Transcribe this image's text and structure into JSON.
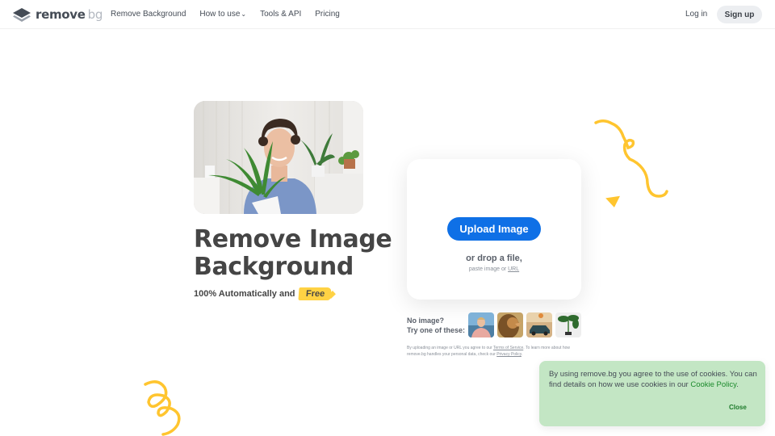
{
  "header": {
    "logo": {
      "main": "remove",
      "suffix": "bg"
    },
    "nav": [
      {
        "label": "Remove Background"
      },
      {
        "label": "How to use",
        "has_dropdown": true
      },
      {
        "label": "Tools & API"
      },
      {
        "label": "Pricing"
      }
    ],
    "login_label": "Log in",
    "signup_label": "Sign up",
    "dropdown_icon": "chevron-down-icon"
  },
  "hero": {
    "image_alt": "Smiling man in blue t-shirt holding a potted plant",
    "title_line1": "Remove Image",
    "title_line2": "Background",
    "subtitle": "100% Automatically and",
    "badge": "Free"
  },
  "upload": {
    "button_label": "Upload Image",
    "drop_text": "or drop a file,",
    "paste_text": "paste image or",
    "url_link": "URL"
  },
  "samples": {
    "label_line1": "No image?",
    "label_line2": "Try one of these:",
    "items": [
      {
        "name": "person"
      },
      {
        "name": "lion"
      },
      {
        "name": "car"
      },
      {
        "name": "plant"
      }
    ]
  },
  "terms": {
    "part1": "By uploading an image or URL you agree to our",
    "terms_link": "Terms of Service",
    "part2": ". To learn more about how remove.bg handles your personal data, check our",
    "privacy_link": "Privacy Policy",
    "part3": "."
  },
  "cookie": {
    "text": "By using remove.bg you agree to the use of cookies. You can find details on how we use cookies in our",
    "link": "Cookie Policy",
    "end": ".",
    "close_label": "Close"
  },
  "colors": {
    "primary": "#0f70e6",
    "accent_yellow": "#ffc52f",
    "cookie_bg": "#c3e6c4",
    "cookie_link": "#1c8a2c",
    "text_dark": "#454545"
  }
}
